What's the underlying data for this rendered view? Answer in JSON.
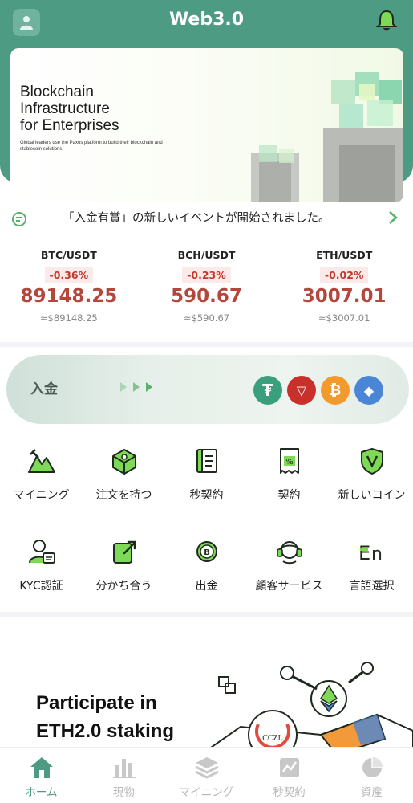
{
  "header": {
    "title": "Web3.0"
  },
  "banner": {
    "title_lines": [
      "Blockchain",
      "Infrastructure",
      "for Enterprises"
    ],
    "subtitle": "Global leaders use the Paxos platform to build their blockchain and stablecoin solutions."
  },
  "notice": {
    "text": "「入金有賞」の新しいイベントが開始されました。"
  },
  "tickers": [
    {
      "pair": "BTC/USDT",
      "change": "-0.36%",
      "price": "89148.25",
      "approx": "≈$89148.25"
    },
    {
      "pair": "BCH/USDT",
      "change": "-0.23%",
      "price": "590.67",
      "approx": "≈$590.67"
    },
    {
      "pair": "ETH/USDT",
      "change": "-0.02%",
      "price": "3007.01",
      "approx": "≈$3007.01"
    }
  ],
  "deposit": {
    "label": "入金",
    "coins": [
      {
        "icon": "tether-icon",
        "glyph": "₮",
        "color": "#3a9f7d"
      },
      {
        "icon": "tron-icon",
        "glyph": "▽",
        "color": "#c9302c"
      },
      {
        "icon": "bitcoin-icon",
        "glyph": "₿",
        "color": "#f39a2d"
      },
      {
        "icon": "ethereum-icon",
        "glyph": "◆",
        "color": "#4b86d6"
      }
    ]
  },
  "grid": {
    "row1": [
      {
        "label": "マイニング",
        "icon": "mining-icon"
      },
      {
        "label": "注文を持つ",
        "icon": "order-box-icon"
      },
      {
        "label": "秒契約",
        "icon": "document-icon"
      },
      {
        "label": "契約",
        "icon": "contract-receipt-icon"
      },
      {
        "label": "新しいコイン",
        "icon": "new-coin-shield-icon"
      }
    ],
    "row2": [
      {
        "label": "KYC認証",
        "icon": "kyc-user-icon"
      },
      {
        "label": "分かち合う",
        "icon": "share-icon"
      },
      {
        "label": "出金",
        "icon": "withdraw-coin-icon"
      },
      {
        "label": "顧客サービス",
        "icon": "customer-service-icon"
      },
      {
        "label": "言語選択",
        "icon": "language-icon"
      }
    ]
  },
  "promo": {
    "title_lines": [
      "Participate in",
      "ETH2.0 staking"
    ],
    "art_text": "CCZL"
  },
  "tabbar": [
    {
      "label": "ホーム",
      "icon": "home-icon",
      "active": true
    },
    {
      "label": "現物",
      "icon": "bar-chart-icon",
      "active": false
    },
    {
      "label": "マイニング",
      "icon": "layers-icon",
      "active": false
    },
    {
      "label": "秒契約",
      "icon": "line-chart-icon",
      "active": false
    },
    {
      "label": "資産",
      "icon": "pie-chart-icon",
      "active": false
    }
  ],
  "colors": {
    "brand": "#4d9b83",
    "down": "#b4473c",
    "icon_green": "#3d9a55"
  }
}
